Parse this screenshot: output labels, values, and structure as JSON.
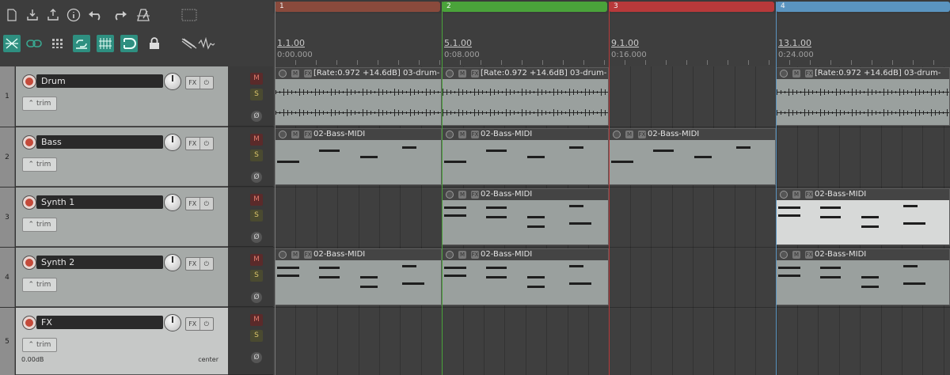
{
  "toolbar": {
    "row1_icons": [
      "new-file-icon",
      "save-icon",
      "open-icon",
      "info-icon",
      "undo-icon",
      "redo-icon",
      "metronome-icon",
      "grid-icon"
    ],
    "row2_icons": [
      "ripple-edit-icon",
      "link-icon",
      "snap-grid-icon",
      "auto-crossfade-icon",
      "grid-lines-icon",
      "loop-icon",
      "lock-icon",
      "envelope-tool-icon",
      "waveform-tool-icon"
    ]
  },
  "tracks": [
    {
      "number": "1",
      "name": "Drum",
      "fx_label": "FX",
      "trim_label": "trim",
      "mute": "M",
      "solo": "S",
      "phase": "Ø"
    },
    {
      "number": "2",
      "name": "Bass",
      "fx_label": "FX",
      "trim_label": "trim",
      "mute": "M",
      "solo": "S",
      "phase": "Ø"
    },
    {
      "number": "3",
      "name": "Synth 1",
      "fx_label": "FX",
      "trim_label": "trim",
      "mute": "M",
      "solo": "S",
      "phase": "Ø"
    },
    {
      "number": "4",
      "name": "Synth 2",
      "fx_label": "FX",
      "trim_label": "trim",
      "mute": "M",
      "solo": "S",
      "phase": "Ø"
    },
    {
      "number": "5",
      "name": "FX",
      "fx_label": "FX",
      "trim_label": "trim",
      "mute": "M",
      "solo": "S",
      "phase": "Ø",
      "volume": "0.00dB",
      "pan": "center"
    }
  ],
  "regions": [
    {
      "label": "1",
      "color": "#8a4a3c"
    },
    {
      "label": "2",
      "color": "#4aa33a"
    },
    {
      "label": "3",
      "color": "#b8393a"
    },
    {
      "label": "4",
      "color": "#5a94c0"
    }
  ],
  "ruler": [
    {
      "measure": "1.1.00",
      "time": "0:00.000"
    },
    {
      "measure": "5.1.00",
      "time": "0:08.000"
    },
    {
      "measure": "9.1.00",
      "time": "0:16.000"
    },
    {
      "measure": "13.1.00",
      "time": "0:24.000"
    }
  ],
  "items": {
    "drum_label": "[Rate:0.972 +14.6dB] 03-drum-",
    "drum_label_full": "[Rate:0.972 +14.6dB] 03-drum-",
    "midi_label": "02-Bass-MIDI",
    "m_icon": "M",
    "fx_icon": "FX"
  }
}
